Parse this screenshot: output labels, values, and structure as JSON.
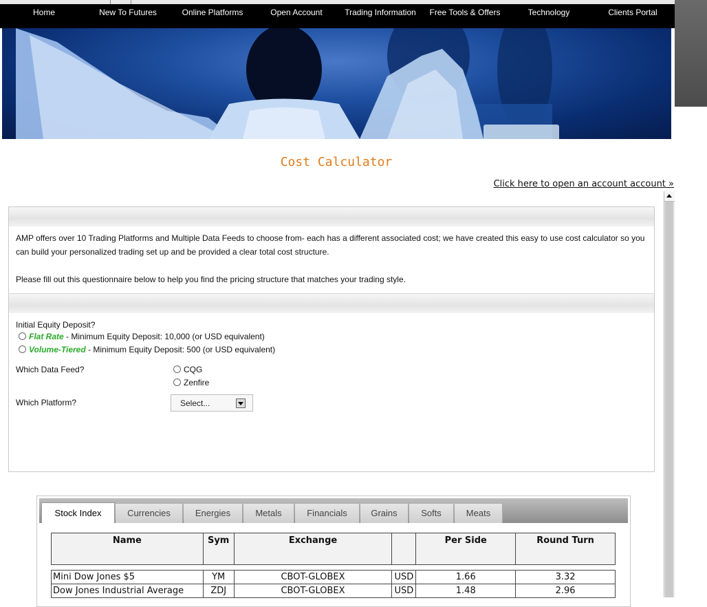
{
  "nav": [
    "Home",
    "New To Futures",
    "Online Platforms",
    "Open Account",
    "Trading Information",
    "Free Tools & Offers",
    "Technology",
    "Clients Portal"
  ],
  "title": "Cost Calculator",
  "open_account_link": "Click here to open an account account »",
  "intro": {
    "p1": "AMP offers over 10 Trading Platforms and Multiple Data Feeds to choose from- each has a different associated cost; we have created this easy to use cost calculator so you can build your personalized trading set up and be provided a clear total cost structure.",
    "p2": "Please fill out this questionnaire below to help you find the pricing structure that matches your trading style."
  },
  "form": {
    "equity_label": "Initial Equity Deposit?",
    "flat_rate_name": "Flat Rate",
    "flat_rate_desc": " - Minimum Equity Deposit: 10,000 (or USD equivalent)",
    "volume_name": "Volume-Tiered",
    "volume_desc": " - Minimum Equity Deposit: 500 (or USD equivalent)",
    "feed_label": "Which Data Feed?",
    "feed_options": [
      "CQG",
      "Zenfire"
    ],
    "platform_label": "Which Platform?",
    "platform_value": "Select..."
  },
  "tabs": [
    "Stock Index",
    "Currencies",
    "Energies",
    "Metals",
    "Financials",
    "Grains",
    "Softs",
    "Meats"
  ],
  "table": {
    "headers": [
      "Name",
      "Sym",
      "Exchange",
      "",
      "Per Side",
      "Round Turn"
    ],
    "rows": [
      [
        "Mini Dow Jones $5",
        "YM",
        "CBOT-GLOBEX",
        "USD",
        "1.66",
        "3.32"
      ],
      [
        "Dow Jones Industrial Average",
        "ZDJ",
        "CBOT-GLOBEX",
        "USD",
        "1.48",
        "2.96"
      ]
    ]
  },
  "colors": {
    "title": "#e07b1c",
    "plan_name": "#2aaa2a",
    "nav_bg": "#000000"
  }
}
